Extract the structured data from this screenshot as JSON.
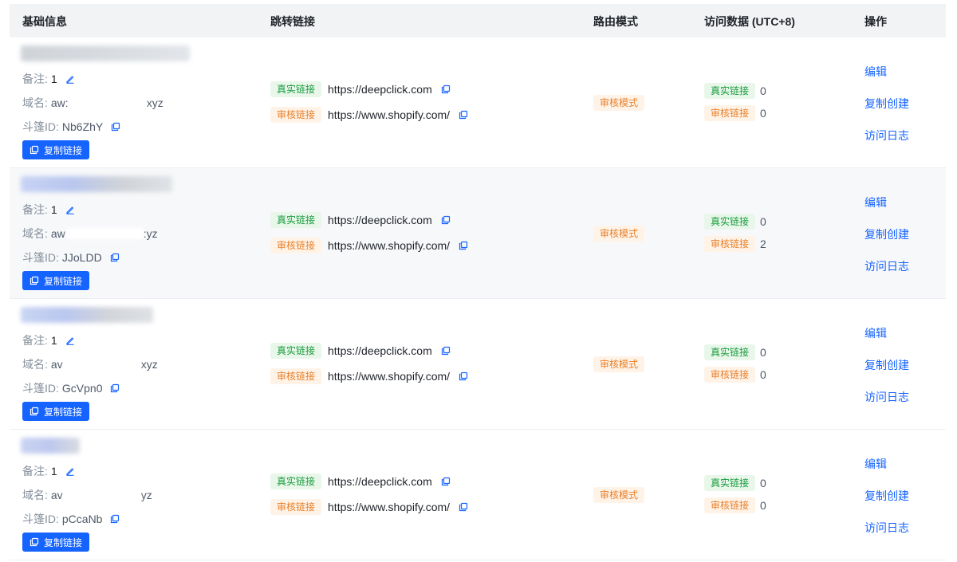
{
  "headers": {
    "basic_info": "基础信息",
    "redirect_link": "跳转链接",
    "route_mode": "路由模式",
    "visit_data": "访问数据 (UTC+8)",
    "actions": "操作"
  },
  "labels": {
    "note": "备注:",
    "domain": "域名:",
    "id": "斗篷ID:",
    "copy_link": "复制链接",
    "real_link": "真实链接",
    "review_link": "审核链接",
    "edit": "编辑",
    "copy_create": "复制创建",
    "visit_log": "访问日志"
  },
  "colors": {
    "primary": "#1664ff",
    "green_tag_bg": "#e8f7ea",
    "green_tag_text": "#1a9c3e",
    "orange_tag_bg": "#fff3e8",
    "orange_tag_text": "#e8802a"
  },
  "rows": [
    {
      "note": "1",
      "domain_start": "aw:",
      "domain_end": "xyz",
      "cloak_id": "Nb6ZhY",
      "real_url": "https://deepclick.com",
      "review_url": "https://www.shopify.com/",
      "route_mode": "审核模式",
      "real_visits": "0",
      "review_visits": "0"
    },
    {
      "note": "1",
      "domain_start": "aw",
      "domain_end": ":yz",
      "cloak_id": "JJoLDD",
      "real_url": "https://deepclick.com",
      "review_url": "https://www.shopify.com/",
      "route_mode": "审核模式",
      "real_visits": "0",
      "review_visits": "2"
    },
    {
      "note": "1",
      "domain_start": "av",
      "domain_end": "xyz",
      "cloak_id": "GcVpn0",
      "real_url": "https://deepclick.com",
      "review_url": "https://www.shopify.com/",
      "route_mode": "审核模式",
      "real_visits": "0",
      "review_visits": "0"
    },
    {
      "note": "1",
      "domain_start": "av",
      "domain_end": "yz",
      "cloak_id": "pCcaNb",
      "real_url": "https://deepclick.com",
      "review_url": "https://www.shopify.com/",
      "route_mode": "审核模式",
      "real_visits": "0",
      "review_visits": "0"
    }
  ]
}
